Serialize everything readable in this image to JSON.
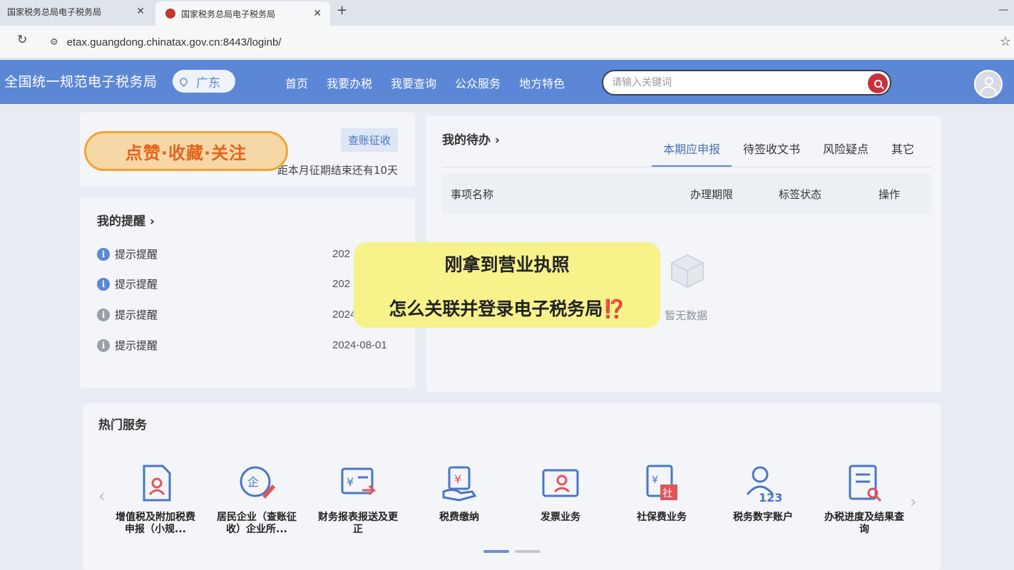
{
  "browser": {
    "tabs": [
      {
        "title": "国家税务总局电子税务局"
      },
      {
        "title": "国家税务总局电子税务局"
      }
    ],
    "url": "etax.guangdong.chinatax.gov.cn:8443/loginb/"
  },
  "header": {
    "site_title": "全国统一规范电子税务局",
    "region": "广东",
    "nav": [
      "首页",
      "我要办税",
      "我要查询",
      "公众服务",
      "地方特色"
    ],
    "search_placeholder": "请输入关键词"
  },
  "top_card": {
    "promo": "点赞·收藏·关注",
    "check_label": "查账征收",
    "deadline": "距本月征期结束还有10天"
  },
  "reminders": {
    "title": "我的提醒 ›",
    "items": [
      {
        "label": "提示提醒",
        "date": "202"
      },
      {
        "label": "提示提醒",
        "date": "202"
      },
      {
        "label": "提示提醒",
        "date": "2024"
      },
      {
        "label": "提示提醒",
        "date": "2024-08-01"
      }
    ]
  },
  "todo": {
    "title": "我的待办 ›",
    "tabs": [
      "本期应申报",
      "待签收文书",
      "风险疑点",
      "其它"
    ],
    "columns": [
      "事项名称",
      "办理期限",
      "标签状态",
      "操作"
    ],
    "empty_text": "暂无数据"
  },
  "overlay": {
    "line1": "刚拿到营业执照",
    "line2": "怎么关联并登录电子税务局",
    "emoji": "⁉️"
  },
  "hot_services": {
    "title": "热门服务",
    "items": [
      {
        "label": "增值税及附加税费申报（小规...",
        "icon": "vat-declare-icon"
      },
      {
        "label": "居民企业（查账征收）企业所...",
        "icon": "enterprise-tax-icon"
      },
      {
        "label": "财务报表报送及更正",
        "icon": "financial-report-icon"
      },
      {
        "label": "税费缴纳",
        "icon": "tax-payment-icon"
      },
      {
        "label": "发票业务",
        "icon": "invoice-icon"
      },
      {
        "label": "社保费业务",
        "icon": "social-security-icon"
      },
      {
        "label": "税务数字账户",
        "icon": "digital-account-icon"
      },
      {
        "label": "办税进度及结果查询",
        "icon": "progress-query-icon"
      }
    ],
    "pages": 2,
    "current_page": 1
  }
}
